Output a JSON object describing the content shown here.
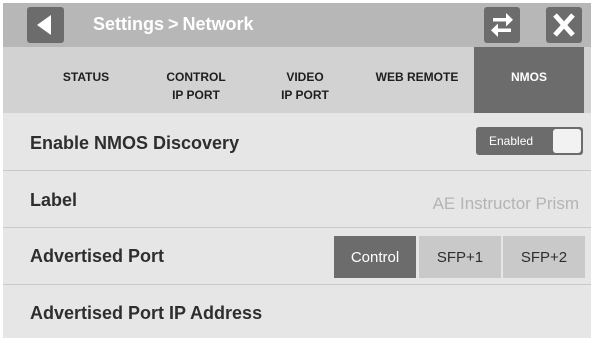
{
  "header": {
    "title_parent": "Settings",
    "title_separator": ">",
    "title_current": "Network",
    "back_icon": "back-arrow-icon",
    "swap_icon": "swap-arrows-icon",
    "close_icon": "close-icon"
  },
  "tabs": [
    {
      "line1": "STATUS",
      "line2": ""
    },
    {
      "line1": "CONTROL",
      "line2": "IP PORT"
    },
    {
      "line1": "VIDEO",
      "line2": "IP PORT"
    },
    {
      "line1": "WEB REMOTE",
      "line2": ""
    },
    {
      "line1": "NMOS",
      "line2": "",
      "active": true
    }
  ],
  "settings": {
    "discovery": {
      "label": "Enable NMOS Discovery",
      "toggle_text": "Enabled",
      "enabled": true
    },
    "label_row": {
      "label": "Label",
      "value": "AE Instructor Prism"
    },
    "advertised_port": {
      "label": "Advertised Port",
      "options": [
        "Control",
        "SFP+1",
        "SFP+2"
      ],
      "selected": "Control"
    },
    "advertised_ip": {
      "label": "Advertised Port IP Address"
    }
  },
  "colors": {
    "header_bg": "#b7b7b7",
    "button_dark": "#6c6c6c",
    "tab_bar": "#d2d2d2",
    "content_bg": "#e6e6e6"
  }
}
